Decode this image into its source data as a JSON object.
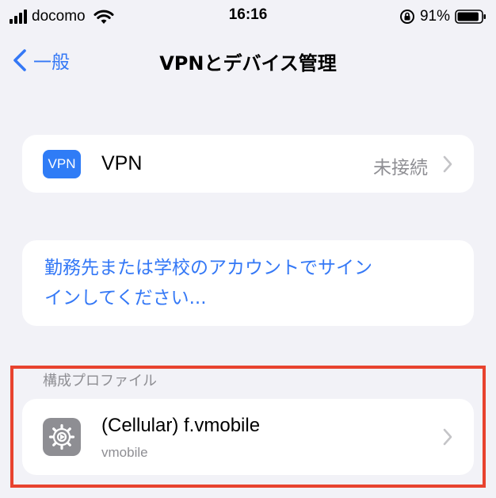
{
  "status_bar": {
    "carrier": "docomo",
    "time": "16:16",
    "battery_percent": "91%",
    "battery_level": 0.91
  },
  "nav": {
    "back_label": "一般",
    "title": "VPNとデバイス管理"
  },
  "vpn_row": {
    "icon_text": "VPN",
    "label": "VPN",
    "status": "未接続"
  },
  "signin": {
    "line1": "勤務先または学校のアカウントでサイン",
    "line2": "インしてください..."
  },
  "profiles_section": {
    "header": "構成プロファイル",
    "items": [
      {
        "name": "(Cellular) f.vmobile",
        "subtitle": "vmobile"
      }
    ]
  },
  "colors": {
    "accent": "#3478f6",
    "vpn_icon_bg": "#2f7cf6",
    "highlight": "#e8432f",
    "background": "#f2f2f7"
  }
}
